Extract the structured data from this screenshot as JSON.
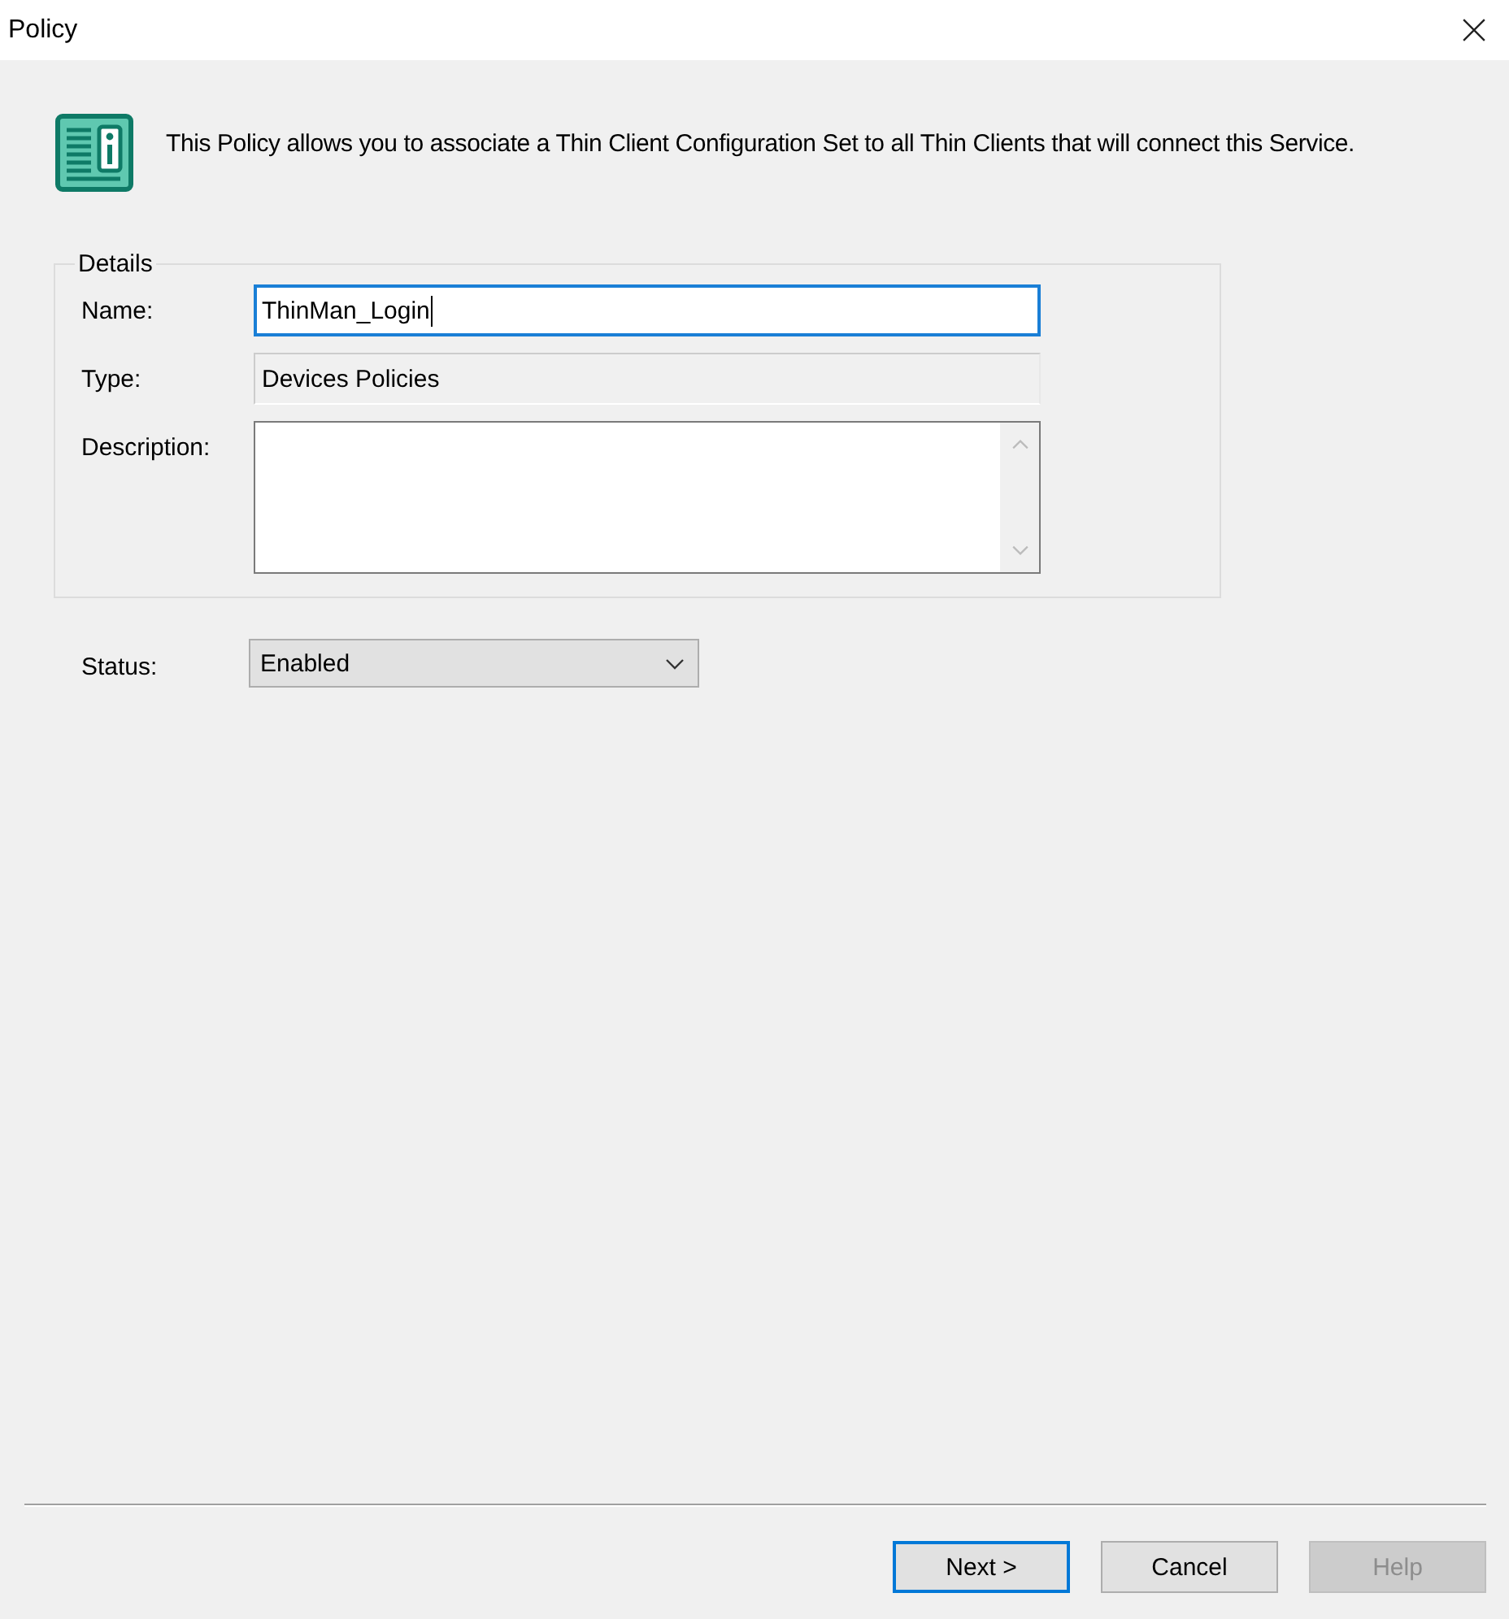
{
  "window": {
    "title": "Policy"
  },
  "intro": "This Policy allows you to associate a Thin Client Configuration Set to all Thin Clients that will connect this Service.",
  "details": {
    "legend": "Details",
    "fields": [
      {
        "kind": "input",
        "label": "Name:",
        "value": "ThinMan_Login",
        "focused": true
      },
      {
        "kind": "readonly",
        "label": "Type:",
        "value": "Devices Policies",
        "focused": false
      },
      {
        "kind": "textarea",
        "label": "Description:",
        "focused": false
      }
    ]
  },
  "status": {
    "label": "Status:",
    "value": "Enabled"
  },
  "buttons": [
    {
      "label": "Next >",
      "default": true,
      "disabled": false
    },
    {
      "label": "Cancel",
      "default": false,
      "disabled": false
    },
    {
      "label": "Help",
      "default": false,
      "disabled": true
    }
  ]
}
